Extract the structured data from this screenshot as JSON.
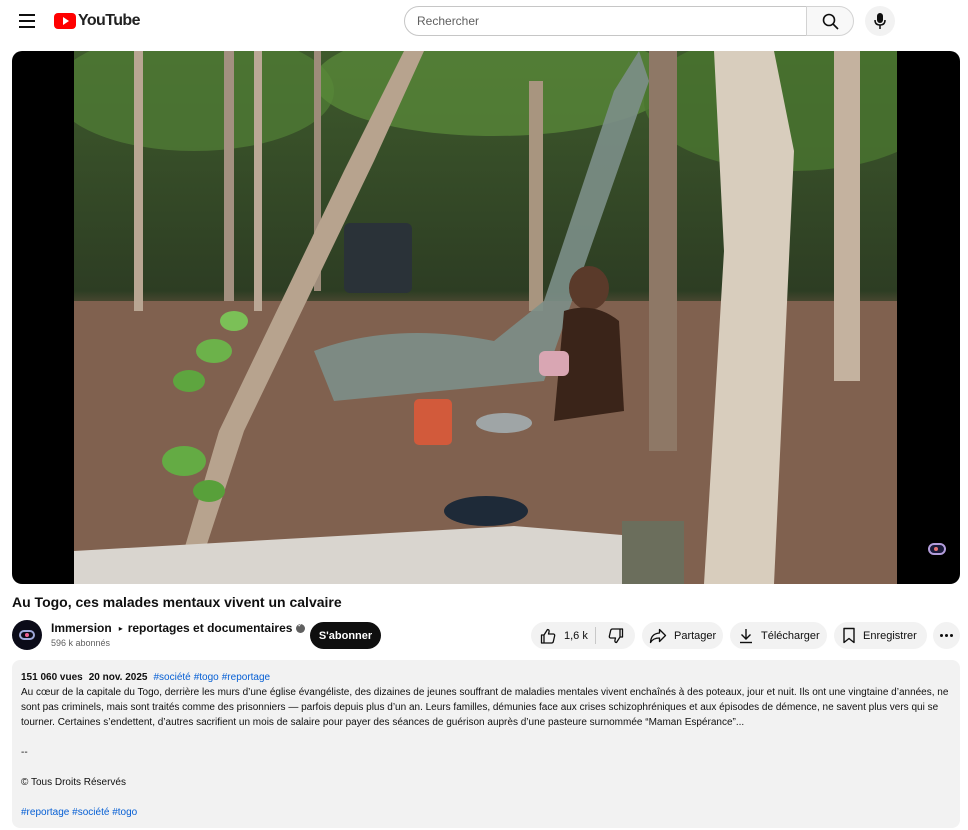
{
  "header": {
    "logo_text": "YouTube",
    "search_placeholder": "Rechercher"
  },
  "video": {
    "title": "Au Togo, ces malades mentaux vivent un calvaire"
  },
  "channel": {
    "name": "Immersion",
    "playlist": "reportages et documentaires",
    "subscribers": "596 k abonnés",
    "subscribe_label": "S'abonner"
  },
  "actions": {
    "likes": "1,6 k",
    "share": "Partager",
    "download": "Télécharger",
    "save": "Enregistrer"
  },
  "description": {
    "views": "151 060 vues",
    "date": "20 nov. 2025",
    "top_tags": [
      "#société",
      "#togo",
      "#reportage"
    ],
    "body": "Au cœur de la capitale du Togo, derrière les murs d’une église évangéliste, des dizaines de jeunes souffrant de maladies mentales vivent enchaînés à des poteaux, jour et nuit. Ils ont une vingtaine d’années, ne sont pas criminels, mais sont traités comme des prisonniers — parfois depuis plus d’un an. Leurs familles, démunies face aux crises schizophréniques et aux épisodes de démence, ne savent plus vers qui se tourner. Certaines s’endettent, d’autres sacrifient un mois de salaire pour payer des séances de guérison auprès d’une pasteure surnommée “Maman Espérance”...",
    "separator": "--",
    "copyright": "© Tous Droits Réservés",
    "bottom_tags": [
      "#reportage",
      "#société",
      "#togo"
    ]
  },
  "colors": {
    "brand_red": "#ff0000",
    "link_blue": "#065fd4",
    "subscribe_bg": "#0f0f0f",
    "pill_bg": "#f2f2f2"
  }
}
